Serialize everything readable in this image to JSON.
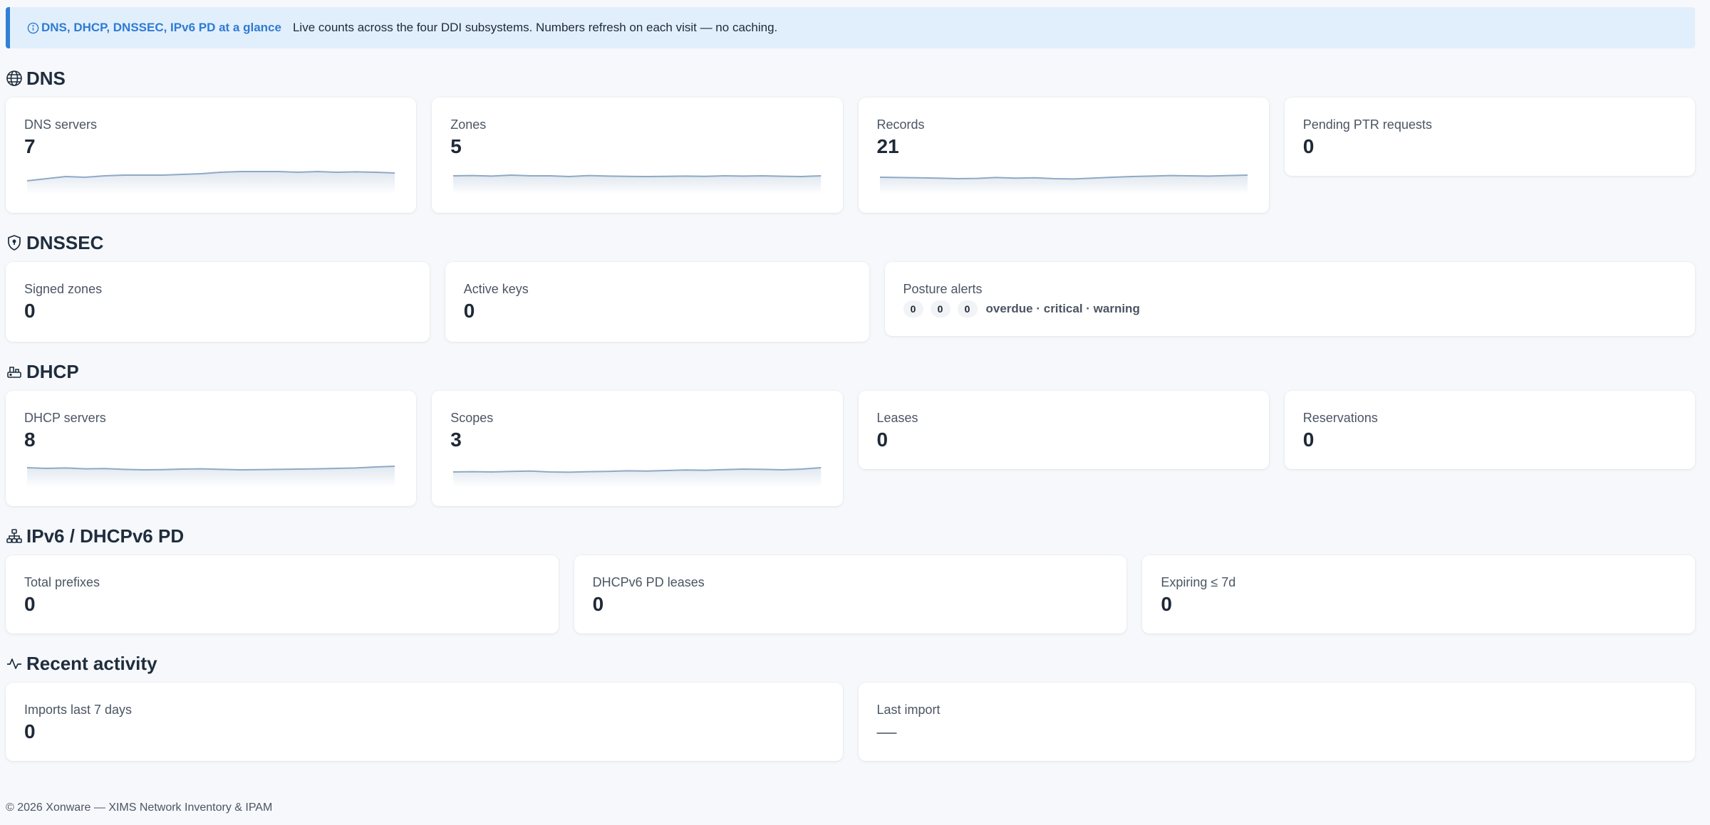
{
  "banner": {
    "title": "DNS, DHCP, DNSSEC, IPv6 PD at a glance",
    "text": "Live counts across the four DDI subsystems. Numbers refresh on each visit — no caching."
  },
  "sections": {
    "dns": {
      "title": "DNS",
      "cards": [
        {
          "label": "DNS servers",
          "value": "7"
        },
        {
          "label": "Zones",
          "value": "5"
        },
        {
          "label": "Records",
          "value": "21"
        },
        {
          "label": "Pending PTR requests",
          "value": "0"
        }
      ]
    },
    "dnssec": {
      "title": "DNSSEC",
      "cards": [
        {
          "label": "Signed zones",
          "value": "0"
        },
        {
          "label": "Active keys",
          "value": "0"
        },
        {
          "label": "Posture alerts",
          "overdue": "0",
          "critical": "0",
          "warning": "0",
          "legend": "overdue · critical · warning"
        }
      ]
    },
    "dhcp": {
      "title": "DHCP",
      "cards": [
        {
          "label": "DHCP servers",
          "value": "8"
        },
        {
          "label": "Scopes",
          "value": "3"
        },
        {
          "label": "Leases",
          "value": "0"
        },
        {
          "label": "Reservations",
          "value": "0"
        }
      ]
    },
    "ipv6": {
      "title": "IPv6 / DHCPv6 PD",
      "cards": [
        {
          "label": "Total prefixes",
          "value": "0"
        },
        {
          "label": "DHCPv6 PD leases",
          "value": "0"
        },
        {
          "label": "Expiring ≤ 7d",
          "value": "0"
        }
      ]
    },
    "activity": {
      "title": "Recent activity",
      "cards": [
        {
          "label": "Imports last 7 days",
          "value": "0"
        },
        {
          "label": "Last import",
          "value": "—"
        }
      ]
    }
  },
  "sparklines": {
    "color": "#8fa9c6",
    "dns_servers": [
      0.15,
      0.3,
      0.45,
      0.4,
      0.5,
      0.55,
      0.55,
      0.55,
      0.6,
      0.65,
      0.75,
      0.8,
      0.8,
      0.8,
      0.75,
      0.8,
      0.75,
      0.78,
      0.75,
      0.7
    ],
    "zones": [
      0.5,
      0.52,
      0.48,
      0.55,
      0.5,
      0.5,
      0.45,
      0.52,
      0.48,
      0.46,
      0.45,
      0.46,
      0.48,
      0.46,
      0.5,
      0.48,
      0.5,
      0.47,
      0.45,
      0.5
    ],
    "records": [
      0.4,
      0.38,
      0.36,
      0.34,
      0.3,
      0.32,
      0.38,
      0.34,
      0.36,
      0.3,
      0.28,
      0.34,
      0.4,
      0.45,
      0.48,
      0.52,
      0.5,
      0.48,
      0.52,
      0.55
    ],
    "dhcp_servers": [
      0.6,
      0.55,
      0.58,
      0.52,
      0.54,
      0.48,
      0.45,
      0.46,
      0.5,
      0.52,
      0.48,
      0.45,
      0.46,
      0.48,
      0.5,
      0.52,
      0.55,
      0.58,
      0.65,
      0.7
    ],
    "scopes": [
      0.3,
      0.32,
      0.3,
      0.34,
      0.36,
      0.3,
      0.28,
      0.32,
      0.34,
      0.38,
      0.36,
      0.4,
      0.44,
      0.42,
      0.46,
      0.5,
      0.48,
      0.45,
      0.5,
      0.6
    ]
  },
  "footer": "© 2026 Xonware — XIMS Network Inventory & IPAM"
}
